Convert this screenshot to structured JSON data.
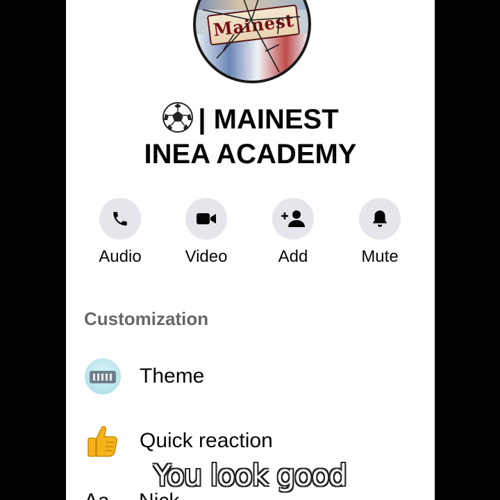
{
  "header": {
    "avatar_logo_text": "Mainest",
    "title_line1": "| MAINEST",
    "title_line2": "INEA ACADEMY",
    "title_emoji_icon": "soccer-ball-icon"
  },
  "actions": [
    {
      "label": "Audio",
      "icon": "phone-icon"
    },
    {
      "label": "Video",
      "icon": "video-camera-icon"
    },
    {
      "label": "Add",
      "icon": "add-person-icon"
    },
    {
      "label": "Mute",
      "icon": "bell-icon"
    }
  ],
  "customization": {
    "section_title": "Customization",
    "items": [
      {
        "label": "Theme",
        "icon": "theme-icon"
      },
      {
        "label": "Quick reaction",
        "icon": "thumbs-up-icon"
      },
      {
        "label": "Nick",
        "icon": "nickname-icon"
      }
    ]
  },
  "overlay_caption": "You look good",
  "colors": {
    "background": "#000000",
    "panel": "#ffffff",
    "action_circle": "#e4e6eb",
    "section_title": "#65676b",
    "text": "#050505"
  }
}
